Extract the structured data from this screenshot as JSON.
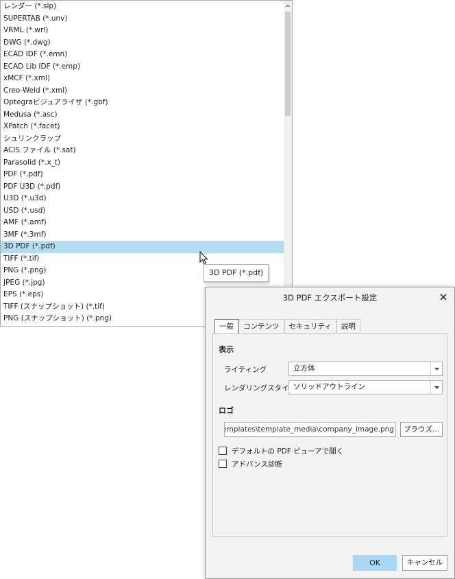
{
  "file_types": {
    "items": [
      "レンダー (*.slp)",
      "SUPERTAB (*.unv)",
      "VRML (*.wrl)",
      "DWG (*.dwg)",
      "ECAD IDF (*.emn)",
      "ECAD Lib IDF (*.emp)",
      "xMCF  (*.xml)",
      "Creo-Weld (*.xml)",
      "Optegraビジュアライザ (*.gbf)",
      "Medusa (*.asc)",
      "XPatch (*.facet)",
      "シュリンクラップ",
      "ACIS ファイル (*.sat)",
      "Parasolid (*.x_t)",
      "PDF (*.pdf)",
      "PDF U3D (*.pdf)",
      "U3D (*.u3d)",
      "USD (*.usd)",
      "AMF (*.amf)",
      "3MF (*.3mf)",
      "3D PDF (*.pdf)",
      "TIFF (*.tif)",
      "PNG (*.png)",
      "JPEG (*.jpg)",
      "EPS  (*.eps)",
      "TIFF (スナップショット) (*.tif)",
      "PNG (スナップショット) (*.png)"
    ],
    "selected_index": 20,
    "tooltip": "3D PDF (*.pdf)"
  },
  "dialog": {
    "title": "3D PDF エクスポート設定",
    "tabs": [
      "一般",
      "コンテンツ",
      "セキュリティ",
      "説明"
    ],
    "active_tab": 0,
    "display_section": "表示",
    "lighting_label": "ライティング",
    "lighting_value": "立方体",
    "render_style_label": "レンダリングスタイル",
    "render_style_value": "ソリッドアウトライン",
    "logo_section": "ロゴ",
    "logo_path": "C:\\Program Files\\PTC\\Creo\\Common Files\\templates\\template_media\\company_image.png",
    "browse_label": "ブラウズ...",
    "open_default_viewer_label": "デフォルトの PDF ビューアで開く",
    "open_default_viewer_checked": false,
    "advanced_diag_label": "アドバンス診断",
    "advanced_diag_checked": false,
    "ok_label": "OK",
    "cancel_label": "キャンセル"
  },
  "icons": {
    "close": "close-icon",
    "dropdown": "chevron-down-icon",
    "scroll_up": "scroll-up-arrow-icon",
    "cursor": "mouse-pointer-icon"
  },
  "colors": {
    "selection": "#b4dcf5",
    "primary_button": "#a8d6f5",
    "dialog_bg": "#f3f3f3"
  }
}
